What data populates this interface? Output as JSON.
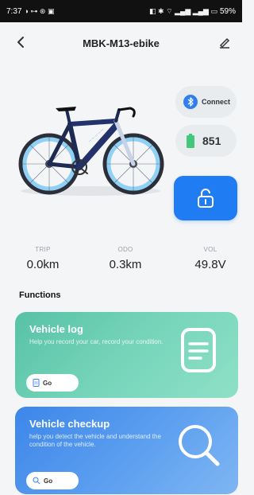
{
  "status_bar": {
    "time": "7:37",
    "battery": "59%"
  },
  "header": {
    "title": "MBK-M13-ebike"
  },
  "controls": {
    "connect_label": "Connect",
    "battery_value": "851"
  },
  "stats": [
    {
      "label": "TRIP",
      "value": "0.0km"
    },
    {
      "label": "ODO",
      "value": "0.3km"
    },
    {
      "label": "VOL",
      "value": "49.8V"
    }
  ],
  "functions": {
    "heading": "Functions",
    "cards": [
      {
        "title": "Vehicle log",
        "description": "Help you record your car, record your condition.",
        "go_label": "Go",
        "color": "#6fd0b4"
      },
      {
        "title": "Vehicle checkup",
        "description": "help you detect the vehicle and understand the condition of the vehicle.",
        "go_label": "Go",
        "color": "#4a90ea"
      }
    ]
  },
  "colors": {
    "accent_blue": "#1f7cf2",
    "battery_green": "#43c77a"
  }
}
